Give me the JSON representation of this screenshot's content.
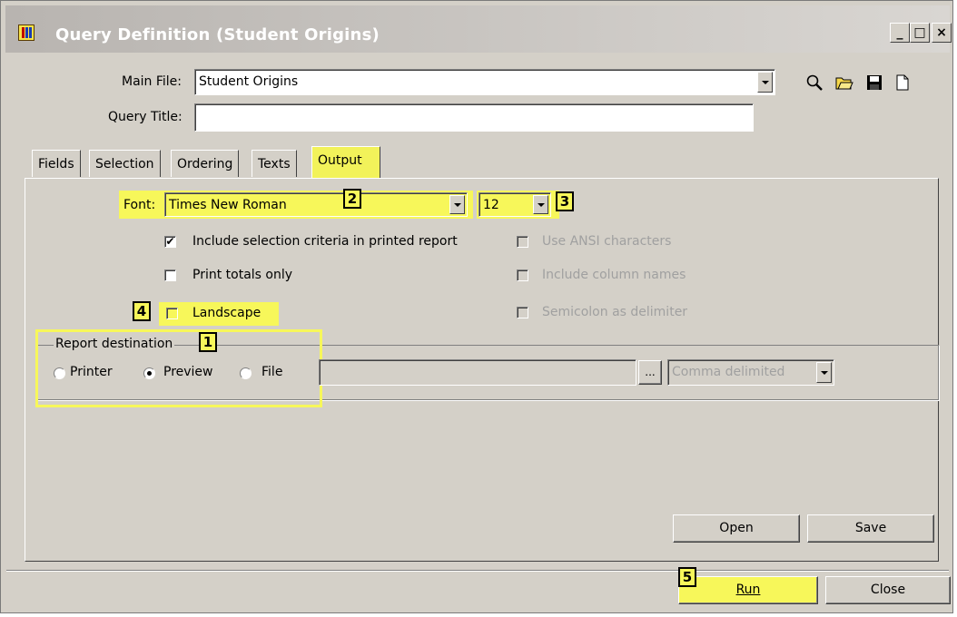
{
  "window": {
    "title": "Query Definition (Student Origins)",
    "controls": {
      "minimize": "_",
      "maximize": "□",
      "close": "×"
    }
  },
  "header": {
    "main_file_label": "Main File:",
    "main_file_value": "Student Origins",
    "query_title_label": "Query Title:",
    "query_title_value": "",
    "toolbar_icons": [
      "search-icon",
      "open-folder-icon",
      "save-disk-icon",
      "new-document-icon"
    ]
  },
  "tabs": [
    "Fields",
    "Selection",
    "Ordering",
    "Texts",
    "Output"
  ],
  "active_tab": "Output",
  "output": {
    "font_label": "Font:",
    "font_value": "Times New Roman",
    "size_value": "12",
    "include_criteria": {
      "label": "Include selection criteria in printed report",
      "checked": true
    },
    "print_totals": {
      "label": "Print totals only",
      "checked": false
    },
    "landscape": {
      "label": "Landscape",
      "checked": false
    },
    "ansi": {
      "label": "Use ANSI characters",
      "checked": false,
      "enabled": false
    },
    "column_names": {
      "label": "Include column names",
      "checked": false,
      "enabled": false
    },
    "semicolon": {
      "label": "Semicolon as delimiter",
      "checked": false,
      "enabled": false
    },
    "report_destination": {
      "legend": "Report destination",
      "options": [
        "Printer",
        "Preview",
        "File"
      ],
      "selected": "Preview",
      "browse_label": "...",
      "format_value": "Comma delimited"
    },
    "open_label": "Open",
    "save_label": "Save"
  },
  "footer": {
    "run_label": "Run",
    "close_label": "Close"
  },
  "annotations": [
    "1",
    "2",
    "3",
    "4",
    "5"
  ],
  "colors": {
    "highlight": "#f7f75a",
    "dialog": "#d4d0c8"
  }
}
